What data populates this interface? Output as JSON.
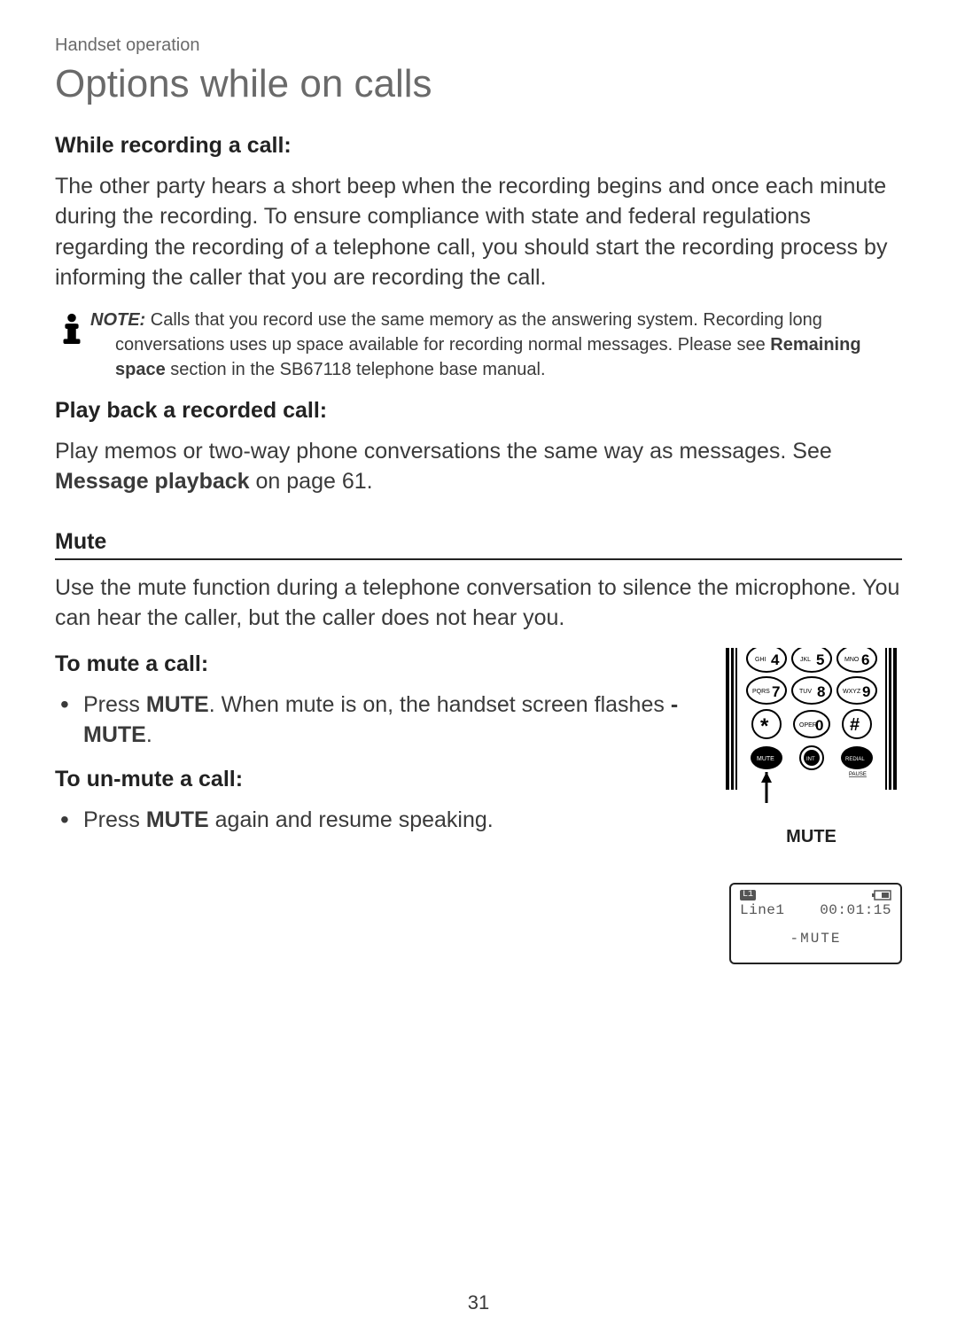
{
  "breadcrumb": "Handset operation",
  "title": "Options while on calls",
  "sec1": {
    "heading": "While recording a call:",
    "body": "The other party hears a short beep when the recording begins and once each minute during the recording. To ensure compliance with state and federal regulations regarding the recording of a telephone call, you should start the recording process by informing the caller that you are recording the call."
  },
  "note": {
    "label": "NOTE:",
    "t1": " Calls that you record use the same memory as the answering system. Recording long conversations uses up space available for recording normal messages. Please see ",
    "bold": "Remaining space",
    "t2": " section in the SB67118 telephone base manual."
  },
  "sec2": {
    "heading": "Play back a recorded call:",
    "p1a": "Play memos or two-way phone conversations the same way as messages. See ",
    "p1b": "Message playback",
    "p1c": " on page 61."
  },
  "mute": {
    "heading": "Mute",
    "intro": "Use the mute function during a telephone conversation to silence the microphone. You can hear the caller, but the caller does not hear you.",
    "sub1": "To mute a call:",
    "li1a": "Press ",
    "li1b": "MUTE",
    "li1c": ". When mute is on, the handset screen flashes ",
    "li1d": "-MUTE",
    "li1e": ".",
    "sub2": "To un-mute a call:",
    "li2a": "Press ",
    "li2b": "MUTE",
    "li2c": " again and resume speaking."
  },
  "keypad": {
    "label": "MUTE",
    "keys": {
      "k4sub": "GHI",
      "k4": "4",
      "k5sub": "JKL",
      "k5": "5",
      "k6sub": "MNO",
      "k6": "6",
      "k7sub": "PQRS",
      "k7": "7",
      "k8sub": "TUV",
      "k8": "8",
      "k9sub": "WXYZ",
      "k9": "9",
      "k0sub": "OPER",
      "k0": "0",
      "kmute": "MUTE",
      "kint": "INT",
      "kredial": "REDIAL",
      "kpause": "PAUSE"
    }
  },
  "lcd": {
    "l1icon": "L1",
    "line": "Line1",
    "time": "00:01:15",
    "status": "-MUTE"
  },
  "pagenum": "31"
}
